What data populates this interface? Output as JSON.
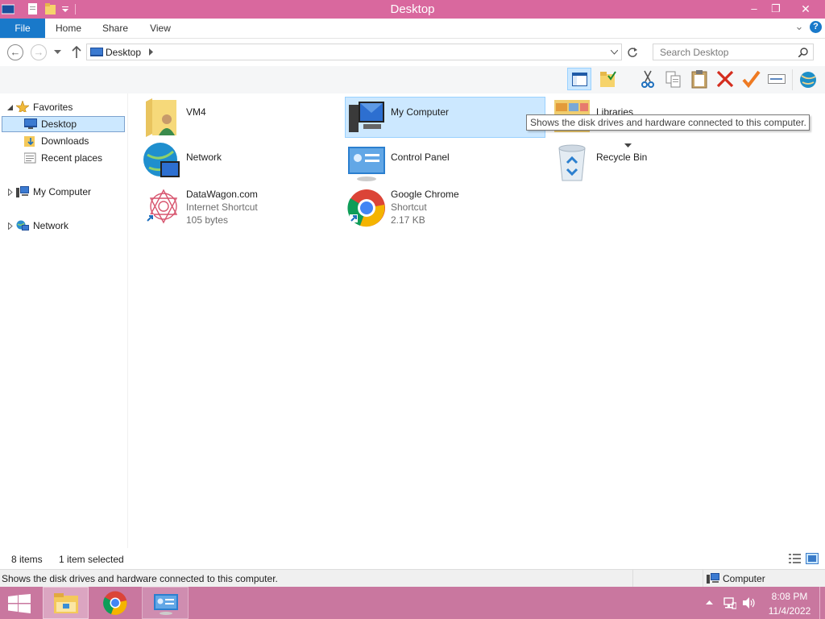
{
  "window": {
    "title": "Desktop",
    "minimize": "–",
    "restore": "❐",
    "close": "✕"
  },
  "ribbon": {
    "tabs": [
      {
        "label": "File"
      },
      {
        "label": "Home"
      },
      {
        "label": "Share"
      },
      {
        "label": "View"
      }
    ],
    "expand": "⌄",
    "help": "?"
  },
  "address": {
    "location": "Desktop",
    "search_placeholder": "Search Desktop"
  },
  "navpane": {
    "items": [
      {
        "label": "Favorites"
      },
      {
        "label": "Desktop"
      },
      {
        "label": "Downloads"
      },
      {
        "label": "Recent places"
      },
      {
        "label": "My Computer"
      },
      {
        "label": "Network"
      }
    ]
  },
  "content": {
    "items": [
      {
        "name": "VM4",
        "type": "",
        "size": ""
      },
      {
        "name": "My Computer",
        "type": "",
        "size": ""
      },
      {
        "name": "Libraries",
        "type": "",
        "size": ""
      },
      {
        "name": "Network",
        "type": "",
        "size": ""
      },
      {
        "name": "Control Panel",
        "type": "",
        "size": ""
      },
      {
        "name": "Recycle Bin",
        "type": "",
        "size": ""
      },
      {
        "name": "DataWagon.com",
        "type": "Internet Shortcut",
        "size": "105 bytes"
      },
      {
        "name": "Google Chrome",
        "type": "Shortcut",
        "size": "2.17 KB"
      }
    ]
  },
  "tooltip": "Shows the disk drives and hardware connected to this computer.",
  "status": {
    "count": "8 items",
    "selected": "1 item selected"
  },
  "bottombar": {
    "message": "Shows the disk drives and hardware connected to this computer.",
    "zone": "Computer"
  },
  "taskbar": {
    "time": "8:08 PM",
    "date": "11/4/2022"
  },
  "colors": {
    "titlebar": "#d9689e",
    "taskbar": "#c9779f",
    "file_tab": "#1979ca",
    "selection": "#cce8ff"
  }
}
